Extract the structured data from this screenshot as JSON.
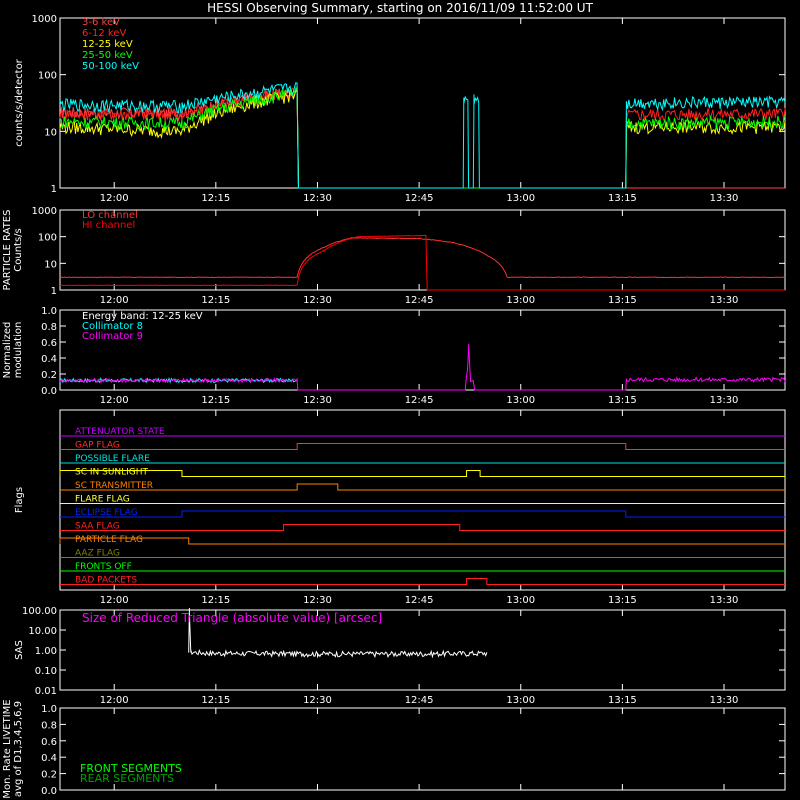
{
  "title": "HESSI Observing Summary, starting on 2016/11/09 11:52:00 UT",
  "chart_data": [
    {
      "type": "line",
      "panel": "count-rates",
      "ylabel": "counts/s/detector",
      "yscale": "log",
      "ylim": [
        1,
        1000
      ],
      "ytick_labels": [
        "1",
        "10",
        "100",
        "1000"
      ],
      "xlim_minutes": [
        -8,
        99
      ],
      "xtick_labels": [
        "12:00",
        "12:15",
        "12:30",
        "12:45",
        "13:00",
        "13:15",
        "13:30"
      ],
      "series": [
        {
          "name": "3-6 keV",
          "color": "#ff4040",
          "points": [
            [
              -8,
              22
            ],
            [
              10,
              21
            ],
            [
              27,
              50
            ],
            [
              27.2,
              1
            ],
            [
              99,
              1
            ]
          ]
        },
        {
          "name": "6-12 keV",
          "color": "#ff2020",
          "points": [
            [
              -8,
              21
            ],
            [
              10,
              20
            ],
            [
              27,
              50
            ],
            [
              27.2,
              1
            ],
            [
              75.5,
              1
            ],
            [
              75.6,
              20
            ],
            [
              99,
              21
            ]
          ]
        },
        {
          "name": "12-25 keV",
          "color": "#ffff00",
          "points": [
            [
              -8,
              12
            ],
            [
              10,
              10
            ],
            [
              27,
              45
            ],
            [
              27.2,
              1
            ],
            [
              75.5,
              1
            ],
            [
              75.6,
              12
            ],
            [
              99,
              12
            ]
          ]
        },
        {
          "name": "25-50 keV",
          "color": "#00ff00",
          "points": [
            [
              -8,
              15
            ],
            [
              10,
              14
            ],
            [
              27,
              48
            ],
            [
              27.2,
              1
            ],
            [
              75.5,
              1
            ],
            [
              75.6,
              14
            ],
            [
              99,
              15
            ]
          ]
        },
        {
          "name": "50-100 keV",
          "color": "#00ffff",
          "points": [
            [
              -8,
              30
            ],
            [
              10,
              28
            ],
            [
              27,
              60
            ],
            [
              27.2,
              1
            ],
            [
              51.5,
              1
            ],
            [
              51.6,
              38
            ],
            [
              52.2,
              38
            ],
            [
              52.3,
              1
            ],
            [
              53,
              1
            ],
            [
              53.1,
              38
            ],
            [
              53.8,
              38
            ],
            [
              53.9,
              1
            ],
            [
              75.5,
              1
            ],
            [
              75.6,
              32
            ],
            [
              99,
              33
            ]
          ]
        }
      ]
    },
    {
      "type": "line",
      "panel": "particle-rates",
      "ylabel": "PARTICLE RATES Counts/s",
      "yscale": "log",
      "ylim": [
        1,
        1000
      ],
      "ytick_labels": [
        "1",
        "10",
        "100",
        "1000"
      ],
      "xtick_labels": [
        "12:00",
        "12:15",
        "12:30",
        "12:45",
        "13:00",
        "13:15",
        "13:30"
      ],
      "series": [
        {
          "name": "LO channel",
          "color": "#ff3030",
          "points": [
            [
              -8,
              3
            ],
            [
              27,
              3
            ],
            [
              31,
              40
            ],
            [
              35,
              90
            ],
            [
              45,
              85
            ],
            [
              50,
              60
            ],
            [
              55,
              20
            ],
            [
              58,
              3
            ],
            [
              99,
              3
            ]
          ]
        },
        {
          "name": "HI channel",
          "color": "#ff0000",
          "points": [
            [
              -8,
              1.5
            ],
            [
              27,
              1.5
            ],
            [
              31,
              30
            ],
            [
              36,
              100
            ],
            [
              45,
              110
            ],
            [
              46,
              110
            ],
            [
              46.2,
              1
            ],
            [
              99,
              1
            ]
          ]
        }
      ]
    },
    {
      "type": "line",
      "panel": "modulation",
      "ylabel": "Normalized modulation",
      "ylim": [
        0,
        1
      ],
      "ytick_labels": [
        "0.0",
        "0.2",
        "0.4",
        "0.6",
        "0.8",
        "1.0"
      ],
      "annotation": "Energy band: 12-25 keV",
      "xtick_labels": [
        "12:00",
        "12:15",
        "12:30",
        "12:45",
        "13:00",
        "13:15",
        "13:30"
      ],
      "series": [
        {
          "name": "Collimator 8",
          "color": "#00ffff",
          "points": [
            [
              -8,
              0.12
            ],
            [
              27,
              0.12
            ]
          ]
        },
        {
          "name": "Collimator 9",
          "color": "#ff00ff",
          "points": [
            [
              -8,
              0.12
            ],
            [
              27,
              0.12
            ],
            [
              27.1,
              0
            ],
            [
              51.8,
              0
            ],
            [
              52,
              0.15
            ],
            [
              52.3,
              0.5
            ],
            [
              52.6,
              0.1
            ],
            [
              53,
              0.1
            ],
            [
              53.2,
              0
            ],
            [
              75.5,
              0
            ],
            [
              75.6,
              0.13
            ],
            [
              99,
              0.13
            ]
          ]
        }
      ]
    },
    {
      "type": "line",
      "panel": "flags",
      "ylabel": "Flags",
      "xtick_labels": [
        "12:00",
        "12:15",
        "12:30",
        "12:45",
        "13:00",
        "13:15",
        "13:30"
      ],
      "series": [
        {
          "name": "ATTENUATOR STATE",
          "color": "#c000ff",
          "segments": []
        },
        {
          "name": "GAP FLAG",
          "color": "#ff3030",
          "segments": [
            [
              27,
              75.5
            ]
          ]
        },
        {
          "name": "POSSIBLE FLARE",
          "color": "#00e0e0",
          "segments": []
        },
        {
          "name": "SC IN SUNLIGHT",
          "color": "#ffff00",
          "segments": [
            [
              -8,
              10
            ],
            [
              52,
              54
            ]
          ]
        },
        {
          "name": "SC TRANSMITTER",
          "color": "#ff8000",
          "segments": [
            [
              27,
              33
            ]
          ]
        },
        {
          "name": "FLARE FLAG",
          "color": "#ffff40",
          "segments": []
        },
        {
          "name": "ECLIPSE FLAG",
          "color": "#0020ff",
          "segments": [
            [
              10,
              75.5
            ]
          ]
        },
        {
          "name": "SAA FLAG",
          "color": "#ff2020",
          "segments": [
            [
              25,
              51
            ]
          ]
        },
        {
          "name": "PARTICLE FLAG",
          "color": "#ff8000",
          "segments": [
            [
              -8,
              11
            ]
          ]
        },
        {
          "name": "AAZ FLAG",
          "color": "#808000",
          "segments": []
        },
        {
          "name": "FRONTS OFF",
          "color": "#00ff00",
          "segments": []
        },
        {
          "name": "BAD PACKETS",
          "color": "#ff2020",
          "segments": [
            [
              52,
              55
            ]
          ]
        }
      ]
    },
    {
      "type": "line",
      "panel": "sas",
      "ylabel": "SAS",
      "yscale": "log",
      "ylim": [
        0.01,
        100
      ],
      "ytick_labels": [
        "0.01",
        "0.10",
        "1.00",
        "10.00",
        "100.00"
      ],
      "annotation": "Size of Reduced Triangle (absolute value) [arcsec]",
      "xtick_labels": [
        "12:00",
        "12:15",
        "12:30",
        "12:45",
        "13:00",
        "13:15",
        "13:30"
      ],
      "series": [
        {
          "name": "triangle size",
          "color": "#ffffff",
          "points": [
            [
              11,
              0.6
            ],
            [
              11.1,
              100
            ],
            [
              11.3,
              0.8
            ],
            [
              14,
              0.7
            ],
            [
              30,
              0.65
            ],
            [
              45,
              0.65
            ],
            [
              55,
              0.7
            ]
          ]
        }
      ]
    },
    {
      "type": "line",
      "panel": "livetime",
      "ylabel": "Mon. Rate LIVETIME avg of D1,3,4,5,6,9",
      "ylim": [
        0,
        1
      ],
      "ytick_labels": [
        "0.0",
        "0.2",
        "0.4",
        "0.6",
        "0.8",
        "1.0"
      ],
      "legend": [
        "FRONT SEGMENTS",
        "REAR SEGMENTS"
      ],
      "legend_colors": [
        "#00ff00",
        "#00a000"
      ],
      "series": []
    }
  ],
  "legend_count": [
    "3-6 keV",
    "6-12 keV",
    "12-25 keV",
    "25-50 keV",
    "50-100 keV"
  ],
  "legend_count_colors": [
    "#ff4040",
    "#ff2020",
    "#ffff00",
    "#00ff00",
    "#00ffff"
  ],
  "legend_particle": [
    "LO channel",
    "HI channel"
  ],
  "legend_particle_colors": [
    "#ff3030",
    "#ff0000"
  ],
  "legend_mod": [
    "Energy band: 12-25 keV",
    "Collimator 8",
    "Collimator 9"
  ],
  "legend_mod_colors": [
    "#ffffff",
    "#00ffff",
    "#ff00ff"
  ],
  "sas_annotation": "Size of Reduced Triangle (absolute value) [arcsec]",
  "livetime_legend": [
    "FRONT SEGMENTS",
    "REAR SEGMENTS"
  ]
}
